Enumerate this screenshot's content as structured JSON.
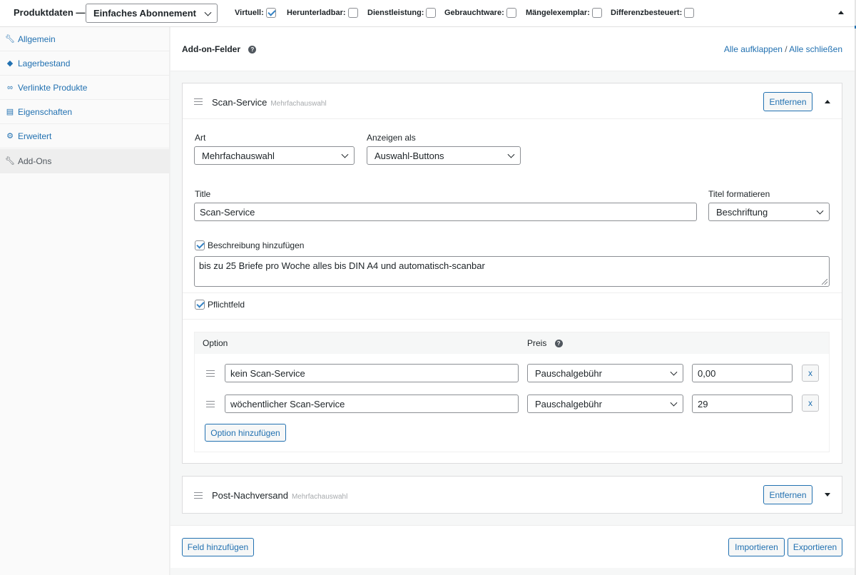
{
  "header": {
    "title": "Produktdaten —",
    "product_type": "Einfaches Abonnement",
    "options": [
      {
        "label": "Virtuell:",
        "checked": true
      },
      {
        "label": "Herunterladbar:",
        "checked": false
      },
      {
        "label": "Dienstleistung:",
        "checked": false
      },
      {
        "label": "Gebrauchtware:",
        "checked": false
      },
      {
        "label": "Mängelexemplar:",
        "checked": false
      },
      {
        "label": "Differenzbesteuert:",
        "checked": false
      }
    ]
  },
  "sidebar": {
    "items": [
      {
        "label": "Allgemein",
        "icon": "wrench-icon",
        "active": false
      },
      {
        "label": "Lagerbestand",
        "icon": "tag-icon",
        "active": false
      },
      {
        "label": "Verlinkte Produkte",
        "icon": "link-icon",
        "active": false
      },
      {
        "label": "Eigenschaften",
        "icon": "list-icon",
        "active": false
      },
      {
        "label": "Erweitert",
        "icon": "gear-icon",
        "active": false
      },
      {
        "label": "Add-Ons",
        "icon": "wrench-icon",
        "active": true
      }
    ]
  },
  "main": {
    "heading": "Add-on-Felder",
    "expand_all": "Alle aufklappen",
    "separator": "/",
    "collapse_all": "Alle schließen"
  },
  "addon1": {
    "name": "Scan-Service",
    "type_hint": "Mehrfachauswahl",
    "remove_label": "Entfernen",
    "art_label": "Art",
    "art_value": "Mehrfachauswahl",
    "display_label": "Anzeigen als",
    "display_value": "Auswahl-Buttons",
    "title_label": "Title",
    "title_value": "Scan-Service",
    "title_format_label": "Titel formatieren",
    "title_format_value": "Beschriftung",
    "add_desc_label": "Beschreibung hinzufügen",
    "add_desc_checked": true,
    "description": "bis zu 25 Briefe pro Woche alles bis DIN A4 und automatisch-scanbar",
    "required_label": "Pflichtfeld",
    "required_checked": true,
    "options_header_option": "Option",
    "options_header_price": "Preis",
    "options": [
      {
        "name": "kein Scan-Service",
        "price_type": "Pauschalgebühr",
        "price": "0,00",
        "remove": "x"
      },
      {
        "name": "wöchentlicher Scan-Service",
        "price_type": "Pauschalgebühr",
        "price": "29",
        "remove": "x"
      }
    ],
    "add_option_label": "Option hinzufügen"
  },
  "addon2": {
    "name": "Post-Nachversand",
    "type_hint": "Mehrfachauswahl",
    "remove_label": "Entfernen"
  },
  "footer": {
    "add_field": "Feld hinzufügen",
    "import": "Importieren",
    "export": "Exportieren"
  },
  "colors": {
    "accent": "#2271b1",
    "text": "#1d2327",
    "border": "#8c8f94"
  }
}
